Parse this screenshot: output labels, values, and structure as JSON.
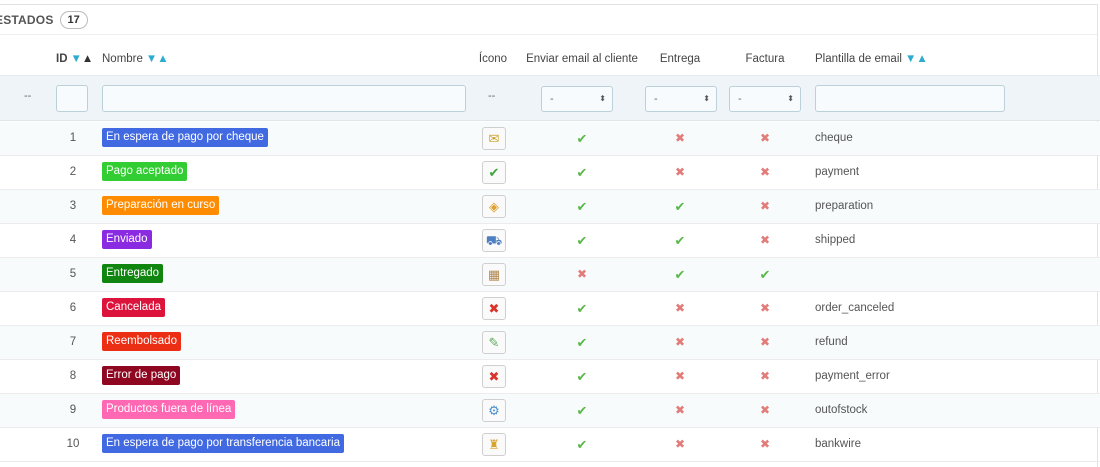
{
  "panel": {
    "title": "ESTADOS",
    "count": "17"
  },
  "columns": {
    "id": "ID",
    "name": "Nombre",
    "icon": "Ícono",
    "send_email": "Enviar email al cliente",
    "delivery": "Entrega",
    "invoice": "Factura",
    "template": "Plantilla de email"
  },
  "sort_icons": {
    "desc": "▼",
    "asc": "▲"
  },
  "filters": {
    "bulk_placeholder": "--",
    "icon_placeholder": "--",
    "send_email_value": "-",
    "delivery_value": "-",
    "invoice_value": "-",
    "caret": "⬍"
  },
  "marks": {
    "yes": "✔",
    "no": "✖"
  },
  "rows": [
    {
      "id": "1",
      "name": "En espera de pago por cheque",
      "color": "#4169e1",
      "icon": "cheque-icon",
      "glyph": "✉",
      "glyph_color": "#c9a227",
      "send_email": true,
      "delivery": false,
      "invoice": false,
      "template": "cheque"
    },
    {
      "id": "2",
      "name": "Pago aceptado",
      "color": "#32cd32",
      "icon": "check-icon",
      "glyph": "✔",
      "glyph_color": "#3aa53a",
      "send_email": true,
      "delivery": false,
      "invoice": false,
      "template": "payment"
    },
    {
      "id": "3",
      "name": "Preparación en curso",
      "color": "#ff8c00",
      "icon": "box-icon",
      "glyph": "◈",
      "glyph_color": "#e0a030",
      "send_email": true,
      "delivery": true,
      "invoice": false,
      "template": "preparation"
    },
    {
      "id": "4",
      "name": "Enviado",
      "color": "#8a2be2",
      "icon": "truck-icon",
      "glyph": "⛟",
      "glyph_color": "#4c7ec0",
      "send_email": true,
      "delivery": true,
      "invoice": false,
      "template": "shipped"
    },
    {
      "id": "5",
      "name": "Entregado",
      "color": "#108510",
      "icon": "package-delivered-icon",
      "glyph": "▦",
      "glyph_color": "#b08850",
      "send_email": false,
      "delivery": true,
      "invoice": true,
      "template": ""
    },
    {
      "id": "6",
      "name": "Cancelada",
      "color": "#dc143c",
      "icon": "cancel-icon",
      "glyph": "✖",
      "glyph_color": "#d9342b",
      "send_email": true,
      "delivery": false,
      "invoice": false,
      "template": "order_canceled"
    },
    {
      "id": "7",
      "name": "Reembolsado",
      "color": "#ec2e15",
      "icon": "refund-icon",
      "glyph": "✎",
      "glyph_color": "#5aa85a",
      "send_email": true,
      "delivery": false,
      "invoice": false,
      "template": "refund"
    },
    {
      "id": "8",
      "name": "Error de pago",
      "color": "#8f0621",
      "icon": "payment-error-icon",
      "glyph": "✖",
      "glyph_color": "#d9342b",
      "send_email": true,
      "delivery": false,
      "invoice": false,
      "template": "payment_error"
    },
    {
      "id": "9",
      "name": "Productos fuera de línea",
      "color": "#ff69b4",
      "icon": "out-of-stock-icon",
      "glyph": "⚙",
      "glyph_color": "#4a8fcf",
      "send_email": true,
      "delivery": false,
      "invoice": false,
      "template": "outofstock"
    },
    {
      "id": "10",
      "name": "En espera de pago por transferencia bancaria",
      "color": "#4169e1",
      "icon": "bankwire-icon",
      "glyph": "♜",
      "glyph_color": "#d8a530",
      "send_email": true,
      "delivery": false,
      "invoice": false,
      "template": "bankwire"
    }
  ]
}
